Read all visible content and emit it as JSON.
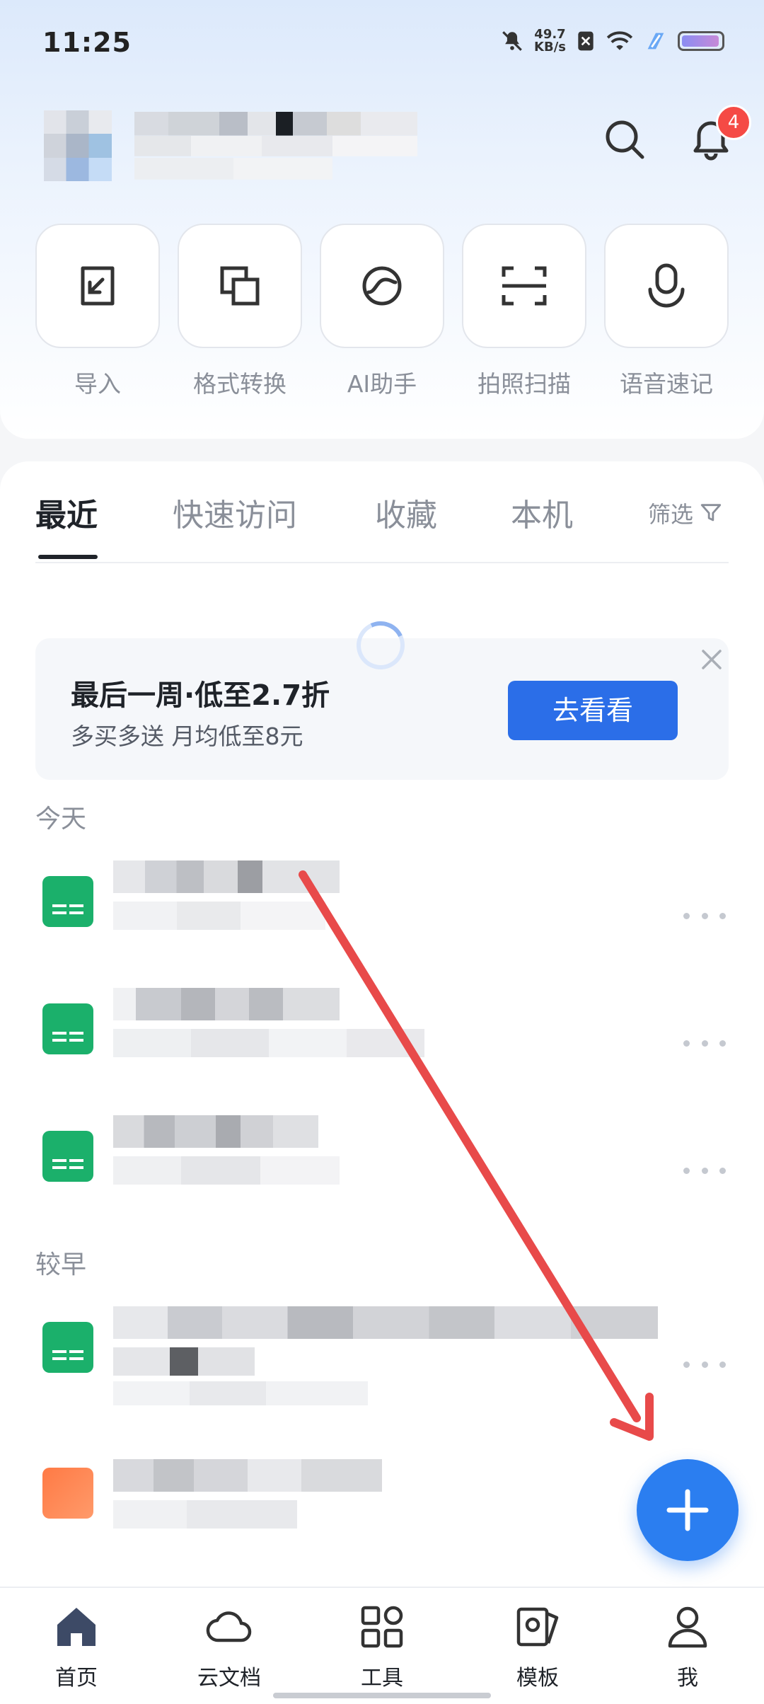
{
  "status_bar": {
    "time": "11:25",
    "speed_value": "49.7",
    "speed_unit": "KB/s"
  },
  "header": {
    "notification_count": "4"
  },
  "quick_actions": [
    {
      "label": "导入",
      "icon": "import-icon"
    },
    {
      "label": "格式转换",
      "icon": "format-convert-icon"
    },
    {
      "label": "AI助手",
      "icon": "ai-assistant-icon"
    },
    {
      "label": "拍照扫描",
      "icon": "scan-icon"
    },
    {
      "label": "语音速记",
      "icon": "microphone-icon"
    }
  ],
  "tabs": [
    {
      "label": "最近",
      "active": true
    },
    {
      "label": "快速访问",
      "active": false
    },
    {
      "label": "收藏",
      "active": false
    },
    {
      "label": "本机",
      "active": false
    }
  ],
  "filter_label": "筛选",
  "promo": {
    "title": "最后一周·低至2.7折",
    "subtitle": "多买多送 月均低至8元",
    "button": "去看看"
  },
  "sections": {
    "today": "今天",
    "earlier": "较早"
  },
  "bottom_nav": [
    {
      "label": "首页",
      "icon": "home-icon",
      "active": true
    },
    {
      "label": "云文档",
      "icon": "cloud-icon",
      "active": false
    },
    {
      "label": "工具",
      "icon": "tools-grid-icon",
      "active": false
    },
    {
      "label": "模板",
      "icon": "template-icon",
      "active": false
    },
    {
      "label": "我",
      "icon": "profile-icon",
      "active": false
    }
  ],
  "colors": {
    "accent": "#2b7ef0",
    "promo_button": "#2b6ee8",
    "badge": "#f54a45",
    "sheet_icon": "#1bb06b",
    "annotation_arrow": "#e84a4a"
  }
}
